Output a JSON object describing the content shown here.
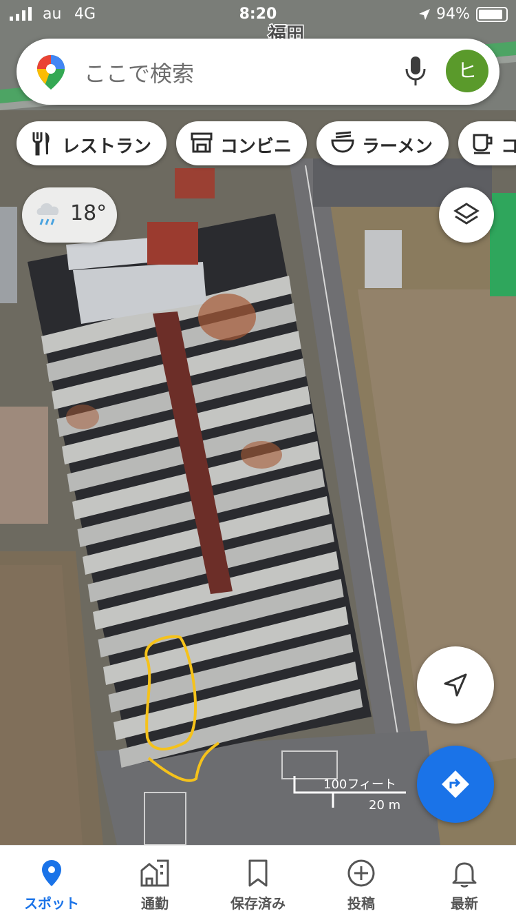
{
  "status_bar": {
    "carrier": "au",
    "network": "4G",
    "time": "8:20",
    "battery_percent": "94%",
    "battery_level": 0.94
  },
  "map": {
    "place_label": "福田",
    "scale_feet": "100フィート",
    "scale_meters": "20 m",
    "view": "satellite"
  },
  "search": {
    "placeholder": "ここで検索",
    "avatar_letter": "ヒ"
  },
  "chips": [
    {
      "label": "レストラン",
      "icon": "restaurant-icon"
    },
    {
      "label": "コンビニ",
      "icon": "convenience-store-icon"
    },
    {
      "label": "ラーメン",
      "icon": "ramen-icon"
    },
    {
      "label": "コ",
      "icon": "cafe-icon"
    }
  ],
  "weather": {
    "temperature": "18°",
    "icon": "rain-cloud-icon"
  },
  "buttons": {
    "layers": "layers-icon",
    "my_location": "navigation-arrow-icon",
    "directions": "directions-icon"
  },
  "tabs": [
    {
      "label": "スポット",
      "icon": "location-pin-icon",
      "active": true
    },
    {
      "label": "通勤",
      "icon": "commute-building-icon",
      "active": false
    },
    {
      "label": "保存済み",
      "icon": "bookmark-icon",
      "active": false
    },
    {
      "label": "投稿",
      "icon": "add-circle-icon",
      "active": false
    },
    {
      "label": "最新",
      "icon": "bell-icon",
      "active": false
    }
  ],
  "colors": {
    "accent": "#1a73e8",
    "annotation": "#f5c21b",
    "avatar": "#5a9a2b"
  }
}
